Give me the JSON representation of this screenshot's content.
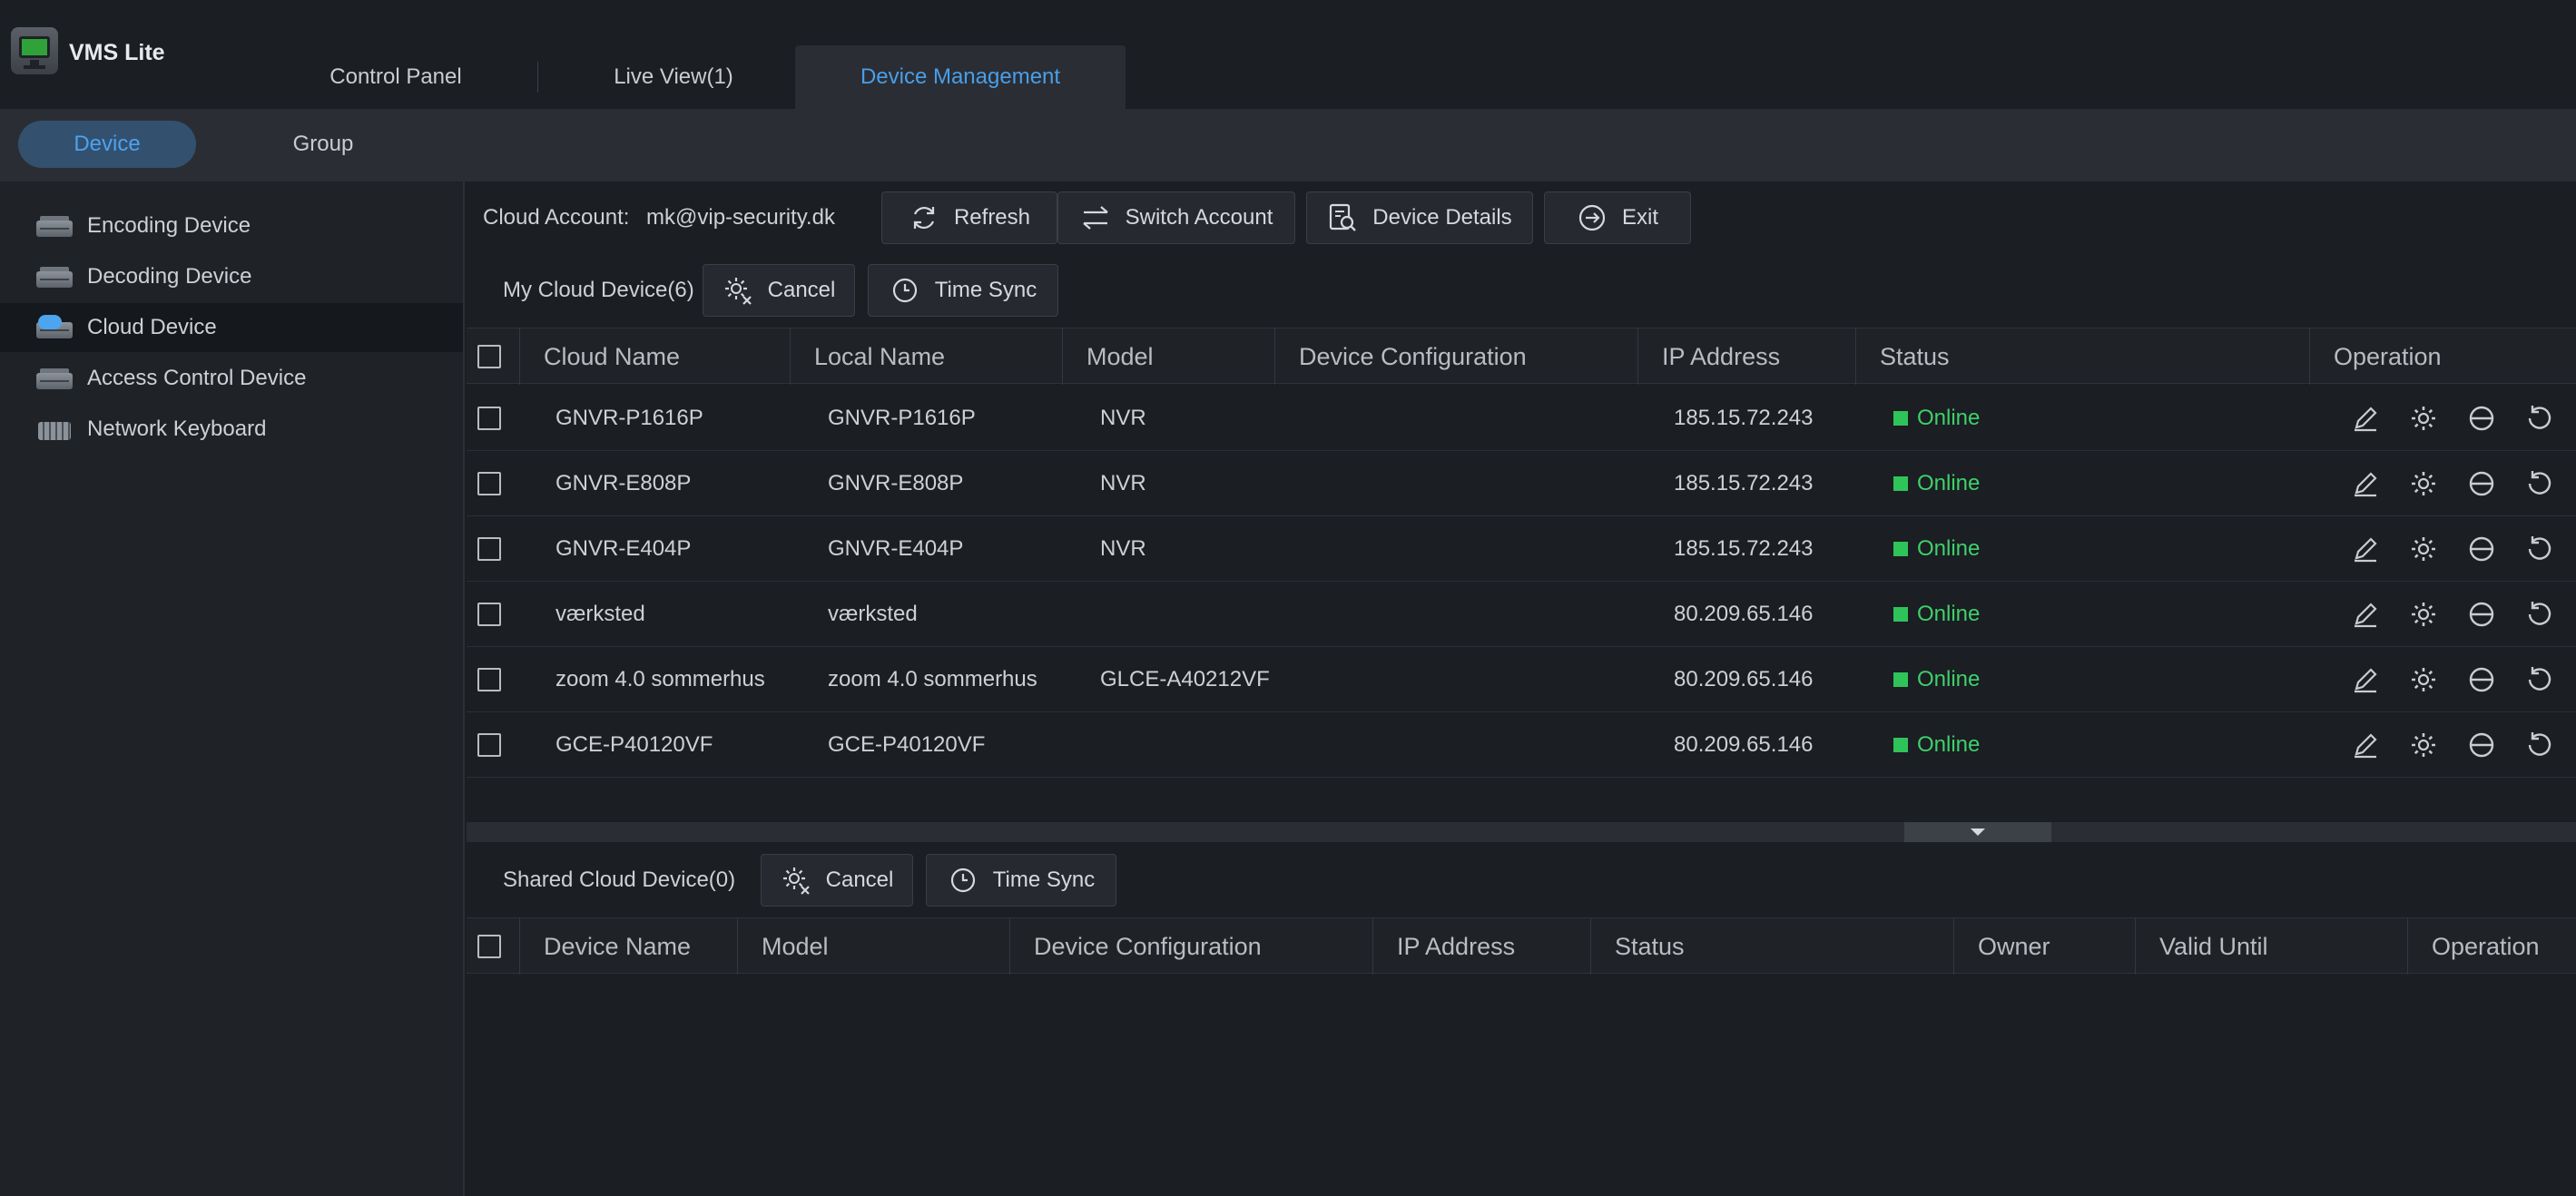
{
  "app": {
    "title": "VMS Lite"
  },
  "tabs": [
    {
      "label": "Control Panel"
    },
    {
      "label": "Live View(1)"
    },
    {
      "label": "Device Management"
    }
  ],
  "subtabs": [
    {
      "label": "Device"
    },
    {
      "label": "Group"
    }
  ],
  "sidebar": {
    "items": [
      {
        "label": "Encoding Device",
        "icon": "encoding-device-icon"
      },
      {
        "label": "Decoding Device",
        "icon": "decoding-device-icon"
      },
      {
        "label": "Cloud Device",
        "icon": "cloud-device-icon"
      },
      {
        "label": "Access Control Device",
        "icon": "access-control-device-icon"
      },
      {
        "label": "Network Keyboard",
        "icon": "network-keyboard-icon"
      }
    ]
  },
  "cloud": {
    "account_label": "Cloud Account:",
    "account_value": "mk@vip-security.dk",
    "buttons": {
      "refresh": "Refresh",
      "switch_account": "Switch Account",
      "device_details": "Device Details",
      "exit": "Exit"
    }
  },
  "my_cloud": {
    "label": "My Cloud Device(6)",
    "cancel": "Cancel",
    "time_sync": "Time Sync",
    "columns": [
      "Cloud Name",
      "Local Name",
      "Model",
      "Device Configuration",
      "IP Address",
      "Status",
      "Operation"
    ],
    "rows": [
      {
        "cloud_name": "GNVR-P1616P",
        "local_name": "GNVR-P1616P",
        "model": "NVR",
        "config": "",
        "ip": "185.15.72.243",
        "status": "Online"
      },
      {
        "cloud_name": "GNVR-E808P",
        "local_name": "GNVR-E808P",
        "model": "NVR",
        "config": "",
        "ip": "185.15.72.243",
        "status": "Online"
      },
      {
        "cloud_name": "GNVR-E404P",
        "local_name": "GNVR-E404P",
        "model": "NVR",
        "config": "",
        "ip": "185.15.72.243",
        "status": "Online"
      },
      {
        "cloud_name": "værksted",
        "local_name": "værksted",
        "model": "",
        "config": "",
        "ip": "80.209.65.146",
        "status": "Online"
      },
      {
        "cloud_name": "zoom 4.0 sommerhus",
        "local_name": "zoom 4.0 sommerhus",
        "model": "GLCE-A40212VF",
        "config": "",
        "ip": "80.209.65.146",
        "status": "Online"
      },
      {
        "cloud_name": "GCE-P40120VF",
        "local_name": "GCE-P40120VF",
        "model": "",
        "config": "",
        "ip": "80.209.65.146",
        "status": "Online"
      }
    ]
  },
  "shared_cloud": {
    "label": "Shared Cloud Device(0)",
    "cancel": "Cancel",
    "time_sync": "Time Sync",
    "columns": [
      "Device Name",
      "Model",
      "Device Configuration",
      "IP Address",
      "Status",
      "Owner",
      "Valid Until",
      "Operation"
    ]
  },
  "colors": {
    "accent": "#4a9ee8",
    "online": "#3fd06a",
    "background": "#1b1e23"
  }
}
